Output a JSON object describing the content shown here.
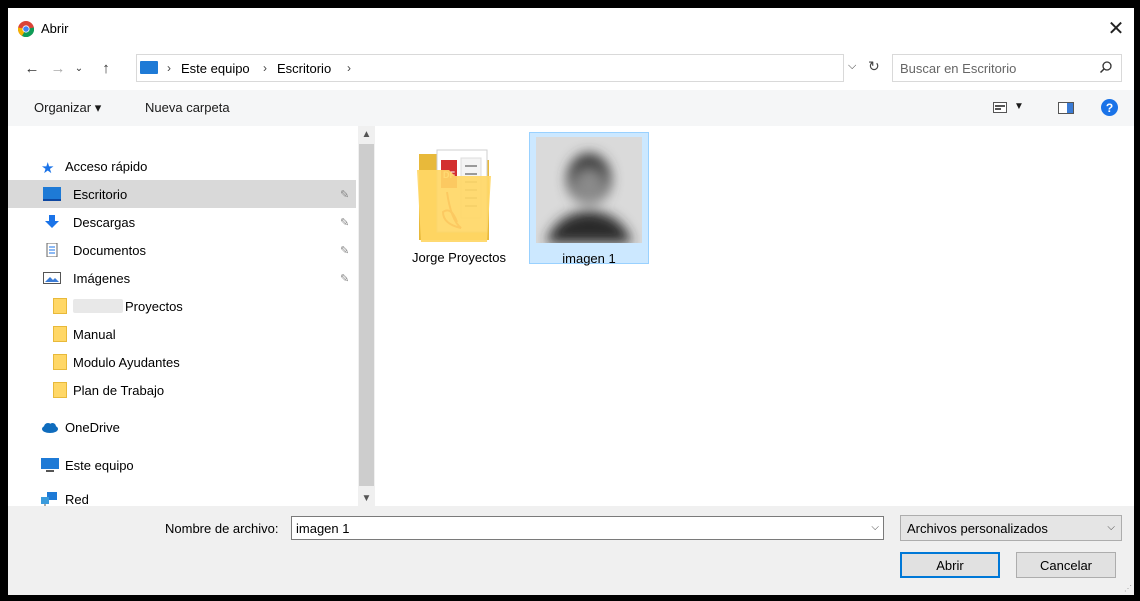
{
  "window": {
    "title": "Abrir"
  },
  "address": {
    "crumbs": [
      "Este equipo",
      "Escritorio"
    ],
    "search_placeholder": "Buscar en Escritorio"
  },
  "toolbar": {
    "organize": "Organizar ▾",
    "new_folder": "Nueva carpeta"
  },
  "nav": {
    "quick_access": "Acceso rápido",
    "items": [
      {
        "label": "Escritorio",
        "pinned": true
      },
      {
        "label": "Descargas",
        "pinned": true
      },
      {
        "label": "Documentos",
        "pinned": true
      },
      {
        "label": "Imágenes",
        "pinned": true
      },
      {
        "label": "Proyectos"
      },
      {
        "label": "Manual"
      },
      {
        "label": "Modulo Ayudantes"
      },
      {
        "label": "Plan de Trabajo"
      }
    ],
    "onedrive": "OneDrive",
    "this_pc": "Este equipo",
    "network": "Red"
  },
  "files": [
    {
      "name": "Jorge Proyectos",
      "type": "folder"
    },
    {
      "name": "imagen 1",
      "type": "image",
      "selected": true
    }
  ],
  "bottom": {
    "filename_label": "Nombre de archivo:",
    "filename_value": "imagen 1",
    "filetype_value": "Archivos personalizados",
    "open_label": "Abrir",
    "cancel_label": "Cancelar"
  },
  "colors": {
    "accent": "#0078d7",
    "selection": "#cce8ff",
    "folder": "#ffd766"
  }
}
